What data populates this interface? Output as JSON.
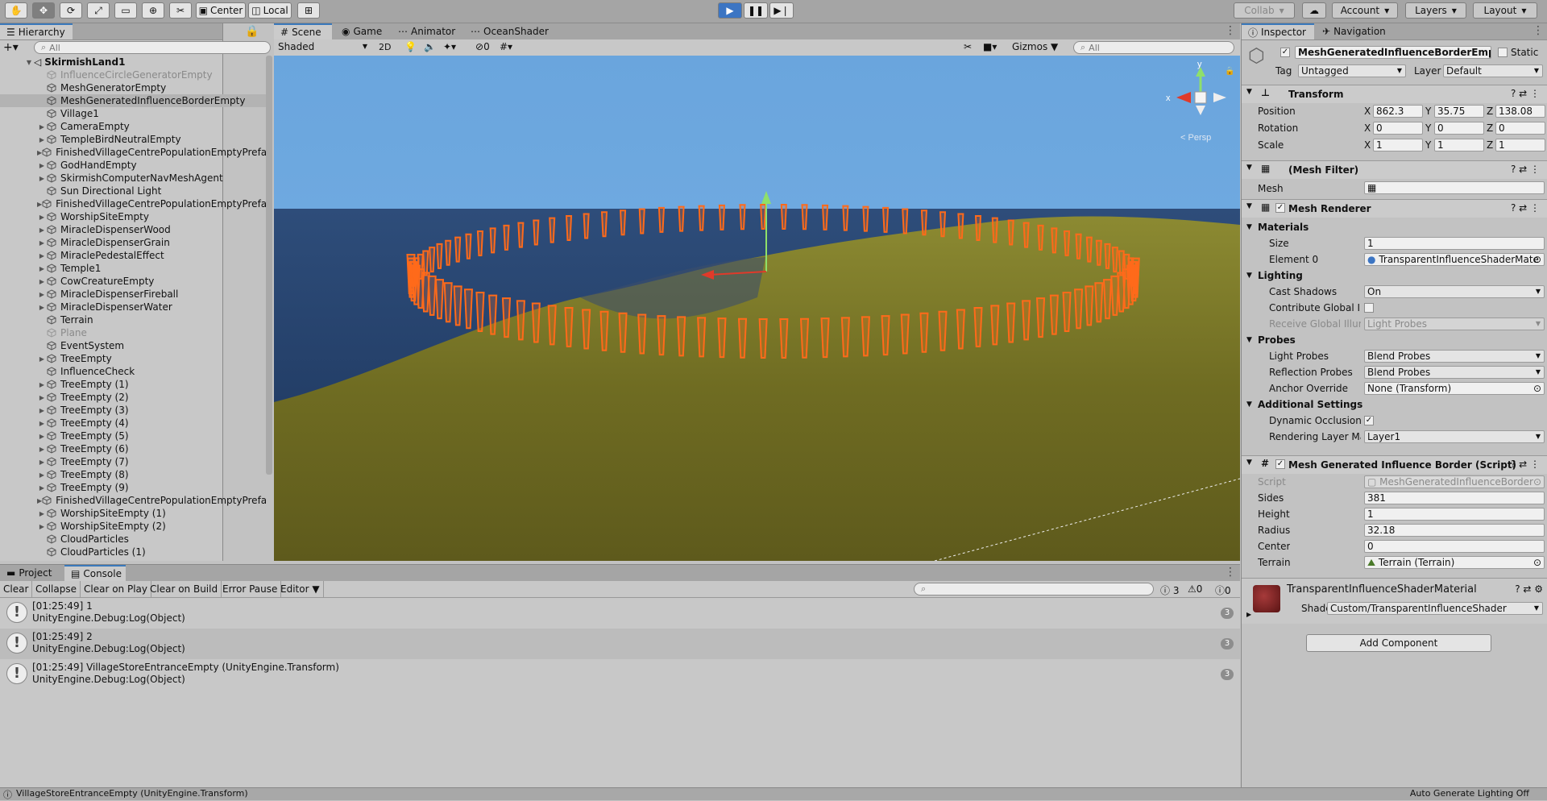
{
  "toolbar": {
    "pivot": "Center",
    "space": "Local",
    "collab": "Collab",
    "account": "Account",
    "layers": "Layers",
    "layout": "Layout"
  },
  "hierarchy": {
    "tab": "Hierarchy",
    "search_placeholder": "All",
    "scene_name": "SkirmishLand1",
    "items": [
      {
        "label": "InfluenceCircleGeneratorEmpty",
        "dim": true,
        "fold": false
      },
      {
        "label": "MeshGeneratorEmpty",
        "dim": false,
        "fold": false
      },
      {
        "label": "MeshGeneratedInfluenceBorderEmpty",
        "dim": false,
        "fold": false,
        "selected": true
      },
      {
        "label": "Village1",
        "dim": false,
        "fold": false
      },
      {
        "label": "CameraEmpty",
        "dim": false,
        "fold": true
      },
      {
        "label": "TempleBirdNeutralEmpty",
        "dim": false,
        "fold": true
      },
      {
        "label": "FinishedVillageCentrePopulationEmptyPrefa",
        "dim": false,
        "fold": true
      },
      {
        "label": "GodHandEmpty",
        "dim": false,
        "fold": true
      },
      {
        "label": "SkirmishComputerNavMeshAgent",
        "dim": false,
        "fold": true
      },
      {
        "label": "Sun Directional Light",
        "dim": false,
        "fold": false
      },
      {
        "label": "FinishedVillageCentrePopulationEmptyPrefa",
        "dim": false,
        "fold": true
      },
      {
        "label": "WorshipSiteEmpty",
        "dim": false,
        "fold": true
      },
      {
        "label": "MiracleDispenserWood",
        "dim": false,
        "fold": true
      },
      {
        "label": "MiracleDispenserGrain",
        "dim": false,
        "fold": true
      },
      {
        "label": "MiraclePedestalEffect",
        "dim": false,
        "fold": true
      },
      {
        "label": "Temple1",
        "dim": false,
        "fold": true
      },
      {
        "label": "CowCreatureEmpty",
        "dim": false,
        "fold": true
      },
      {
        "label": "MiracleDispenserFireball",
        "dim": false,
        "fold": true
      },
      {
        "label": "MiracleDispenserWater",
        "dim": false,
        "fold": true
      },
      {
        "label": "Terrain",
        "dim": false,
        "fold": false
      },
      {
        "label": "Plane",
        "dim": true,
        "fold": false
      },
      {
        "label": "EventSystem",
        "dim": false,
        "fold": false
      },
      {
        "label": "TreeEmpty",
        "dim": false,
        "fold": true
      },
      {
        "label": "InfluenceCheck",
        "dim": false,
        "fold": false
      },
      {
        "label": "TreeEmpty (1)",
        "dim": false,
        "fold": true
      },
      {
        "label": "TreeEmpty (2)",
        "dim": false,
        "fold": true
      },
      {
        "label": "TreeEmpty (3)",
        "dim": false,
        "fold": true
      },
      {
        "label": "TreeEmpty (4)",
        "dim": false,
        "fold": true
      },
      {
        "label": "TreeEmpty (5)",
        "dim": false,
        "fold": true
      },
      {
        "label": "TreeEmpty (6)",
        "dim": false,
        "fold": true
      },
      {
        "label": "TreeEmpty (7)",
        "dim": false,
        "fold": true
      },
      {
        "label": "TreeEmpty (8)",
        "dim": false,
        "fold": true
      },
      {
        "label": "TreeEmpty (9)",
        "dim": false,
        "fold": true
      },
      {
        "label": "FinishedVillageCentrePopulationEmptyPrefa",
        "dim": false,
        "fold": true
      },
      {
        "label": "WorshipSiteEmpty (1)",
        "dim": false,
        "fold": true
      },
      {
        "label": "WorshipSiteEmpty (2)",
        "dim": false,
        "fold": true
      },
      {
        "label": "CloudParticles",
        "dim": false,
        "fold": false
      },
      {
        "label": "CloudParticles (1)",
        "dim": false,
        "fold": false
      }
    ]
  },
  "scene": {
    "tabs": [
      "Scene",
      "Game",
      "Animator",
      "OceanShader"
    ],
    "shading": "Shaded",
    "mode_2d": "2D",
    "hidden_count": "0",
    "gizmos": "Gizmos",
    "search_placeholder": "All",
    "persp": "Persp",
    "axis_x": "x",
    "axis_y": "y"
  },
  "inspector": {
    "tabs": [
      "Inspector",
      "Navigation"
    ],
    "object_name": "MeshGeneratedInfluenceBorderEmpty",
    "static_label": "Static",
    "tag_label": "Tag",
    "tag_value": "Untagged",
    "layer_label": "Layer",
    "layer_value": "Default",
    "transform": {
      "title": "Transform",
      "position_label": "Position",
      "rotation_label": "Rotation",
      "scale_label": "Scale",
      "position": [
        "862.3",
        "35.75",
        "138.08"
      ],
      "rotation": [
        "0",
        "0",
        "0"
      ],
      "scale": [
        "1",
        "1",
        "1"
      ],
      "x": "X",
      "y": "Y",
      "z": "Z"
    },
    "mesh_filter": {
      "title": "(Mesh Filter)",
      "mesh_label": "Mesh"
    },
    "mesh_renderer": {
      "title": "Mesh Renderer",
      "materials": "Materials",
      "size_label": "Size",
      "size": "1",
      "element0_label": "Element 0",
      "element0": "TransparentInfluenceShaderMate",
      "lighting": "Lighting",
      "cast_shadows_label": "Cast Shadows",
      "cast_shadows": "On",
      "contribute_gi_label": "Contribute Global Illu",
      "receive_gi_label": "Receive Global Illum",
      "receive_gi": "Light Probes",
      "probes": "Probes",
      "light_probes_label": "Light Probes",
      "light_probes": "Blend Probes",
      "reflection_probes_label": "Reflection Probes",
      "reflection_probes": "Blend Probes",
      "anchor_override_label": "Anchor Override",
      "anchor_override": "None (Transform)",
      "additional": "Additional Settings",
      "dynamic_occlusion_label": "Dynamic Occlusion",
      "rendering_layer_label": "Rendering Layer Mas",
      "rendering_layer": "Layer1"
    },
    "script": {
      "title": "Mesh Generated Influence Border (Script)",
      "script_label": "Script",
      "script_value": "MeshGeneratedInfluenceBorder",
      "sides_label": "Sides",
      "sides": "381",
      "height_label": "Height",
      "height": "1",
      "radius_label": "Radius",
      "radius": "32.18",
      "center_label": "Center",
      "center": "0",
      "terrain_label": "Terrain",
      "terrain": "Terrain (Terrain)"
    },
    "material": {
      "name": "TransparentInfluenceShaderMaterial",
      "shader_label": "Shader",
      "shader": "Custom/TransparentInfluenceShader"
    },
    "add_component": "Add Component"
  },
  "console": {
    "tabs": [
      "Project",
      "Console"
    ],
    "buttons": [
      "Clear",
      "Collapse",
      "Clear on Play",
      "Clear on Build",
      "Error Pause",
      "Editor"
    ],
    "count_log": "3",
    "count_warn": "0",
    "count_error": "0",
    "logs": [
      {
        "line1": "[01:25:49] 1",
        "line2": "UnityEngine.Debug:Log(Object)",
        "count": "3"
      },
      {
        "line1": "[01:25:49] 2",
        "line2": "UnityEngine.Debug:Log(Object)",
        "count": "3"
      },
      {
        "line1": "[01:25:49] VillageStoreEntranceEmpty (UnityEngine.Transform)",
        "line2": "UnityEngine.Debug:Log(Object)",
        "count": "3"
      }
    ]
  },
  "status": {
    "message": "VillageStoreEntranceEmpty (UnityEngine.Transform)",
    "right": "Auto Generate Lighting Off"
  },
  "colors": {
    "sky": "#6aa5dd",
    "sea": "#1d3b66",
    "terrain": "#7c7a2a",
    "ring": "#ff6a1a",
    "selection_blue": "#3c75c3"
  }
}
